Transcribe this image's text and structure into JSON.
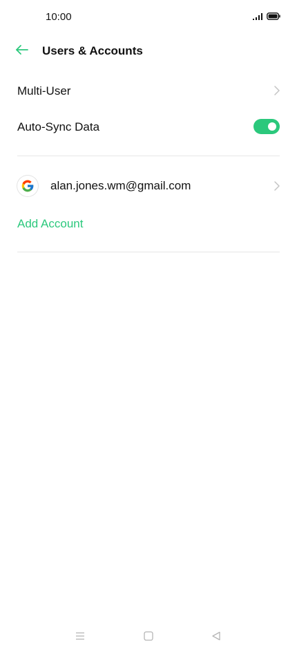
{
  "status_bar": {
    "time": "10:00",
    "icons": [
      "signal-icon",
      "battery-icon"
    ]
  },
  "header": {
    "back_icon": "back-arrow-icon",
    "title": "Users & Accounts"
  },
  "settings": {
    "multi_user_label": "Multi-User",
    "auto_sync_label": "Auto-Sync Data",
    "auto_sync_enabled": true
  },
  "accounts": {
    "items": [
      {
        "provider_icon": "google-icon",
        "email": "alan.jones.wm@gmail.com"
      }
    ],
    "add_account_label": "Add Account"
  },
  "navigation": {
    "icons": [
      "menu-icon",
      "home-icon",
      "back-icon"
    ]
  },
  "colors": {
    "accent": "#2bc87c",
    "divider": "#e6e6e6",
    "text": "#111111",
    "chevron": "#c4c4c4"
  }
}
